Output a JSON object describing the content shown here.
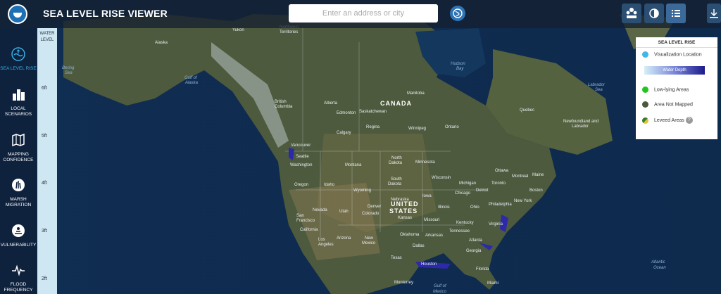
{
  "app": {
    "title": "SEA LEVEL RISE VIEWER"
  },
  "search": {
    "placeholder": "Enter an address or city"
  },
  "sidebar": {
    "items": [
      {
        "label": "SEA LEVEL RISE",
        "icon": "sea-level-icon",
        "active": true
      },
      {
        "label": "LOCAL SCENARIOS",
        "icon": "buildings-icon",
        "active": false
      },
      {
        "label": "MAPPING CONFIDENCE",
        "icon": "map-icon",
        "active": false
      },
      {
        "label": "MARSH MIGRATION",
        "icon": "marsh-icon",
        "active": false
      },
      {
        "label": "VULNERABILITY",
        "icon": "vulnerability-icon",
        "active": false
      },
      {
        "label": "FLOOD FREQUENCY",
        "icon": "flood-frequency-icon",
        "active": false
      }
    ]
  },
  "water_level": {
    "title": "WATER LEVEL",
    "ticks": [
      "6ft",
      "5ft",
      "4ft",
      "3ft",
      "2ft"
    ]
  },
  "legend": {
    "title": "SEA LEVEL RISE",
    "items": [
      {
        "label": "Visualization Location",
        "color": "#3fb8e8"
      },
      {
        "label": "Water Depth",
        "type": "gradient"
      },
      {
        "label": "Low-lying Areas",
        "color": "#23c41f"
      },
      {
        "label": "Area Not Mapped",
        "color": "#4a5a3a"
      },
      {
        "label": "Leveed Areas",
        "color": "#7d8a2e"
      }
    ],
    "help": "?"
  },
  "map_labels": {
    "countries": [
      "CANADA",
      "UNITED STATES"
    ],
    "water": [
      "Gulf of Alaska",
      "Hudson Bay",
      "Labrador Sea",
      "Atlantic Ocean",
      "Gulf of Mexico",
      "Bering Sea"
    ],
    "places": [
      "Yukon",
      "Northwest Territories",
      "Alaska",
      "British Columbia",
      "Alberta",
      "Saskatchewan",
      "Manitoba",
      "Ontario",
      "Quebec",
      "Newfoundland and Labrador",
      "Edmonton",
      "Calgary",
      "Vancouver",
      "Seattle",
      "Washington",
      "Oregon",
      "Idaho",
      "Montana",
      "Wyoming",
      "Nevada",
      "Utah",
      "Colorado",
      "Denver",
      "California",
      "San Francisco",
      "Los Angeles",
      "Arizona",
      "New Mexico",
      "North Dakota",
      "South Dakota",
      "Nebraska",
      "Kansas",
      "Oklahoma",
      "Texas",
      "Dallas",
      "Houston",
      "Minnesota",
      "Iowa",
      "Missouri",
      "Arkansas",
      "Wisconsin",
      "Illinois",
      "Chicago",
      "Michigan",
      "Detroit",
      "Ohio",
      "Kentucky",
      "Tennessee",
      "Georgia",
      "Atlanta",
      "Florida",
      "Miami",
      "Virginia",
      "Philadelphia",
      "New York",
      "Boston",
      "Ottawa",
      "Toronto",
      "Montreal",
      "Maine",
      "Monterrey",
      "Winnipeg",
      "Regina"
    ]
  }
}
